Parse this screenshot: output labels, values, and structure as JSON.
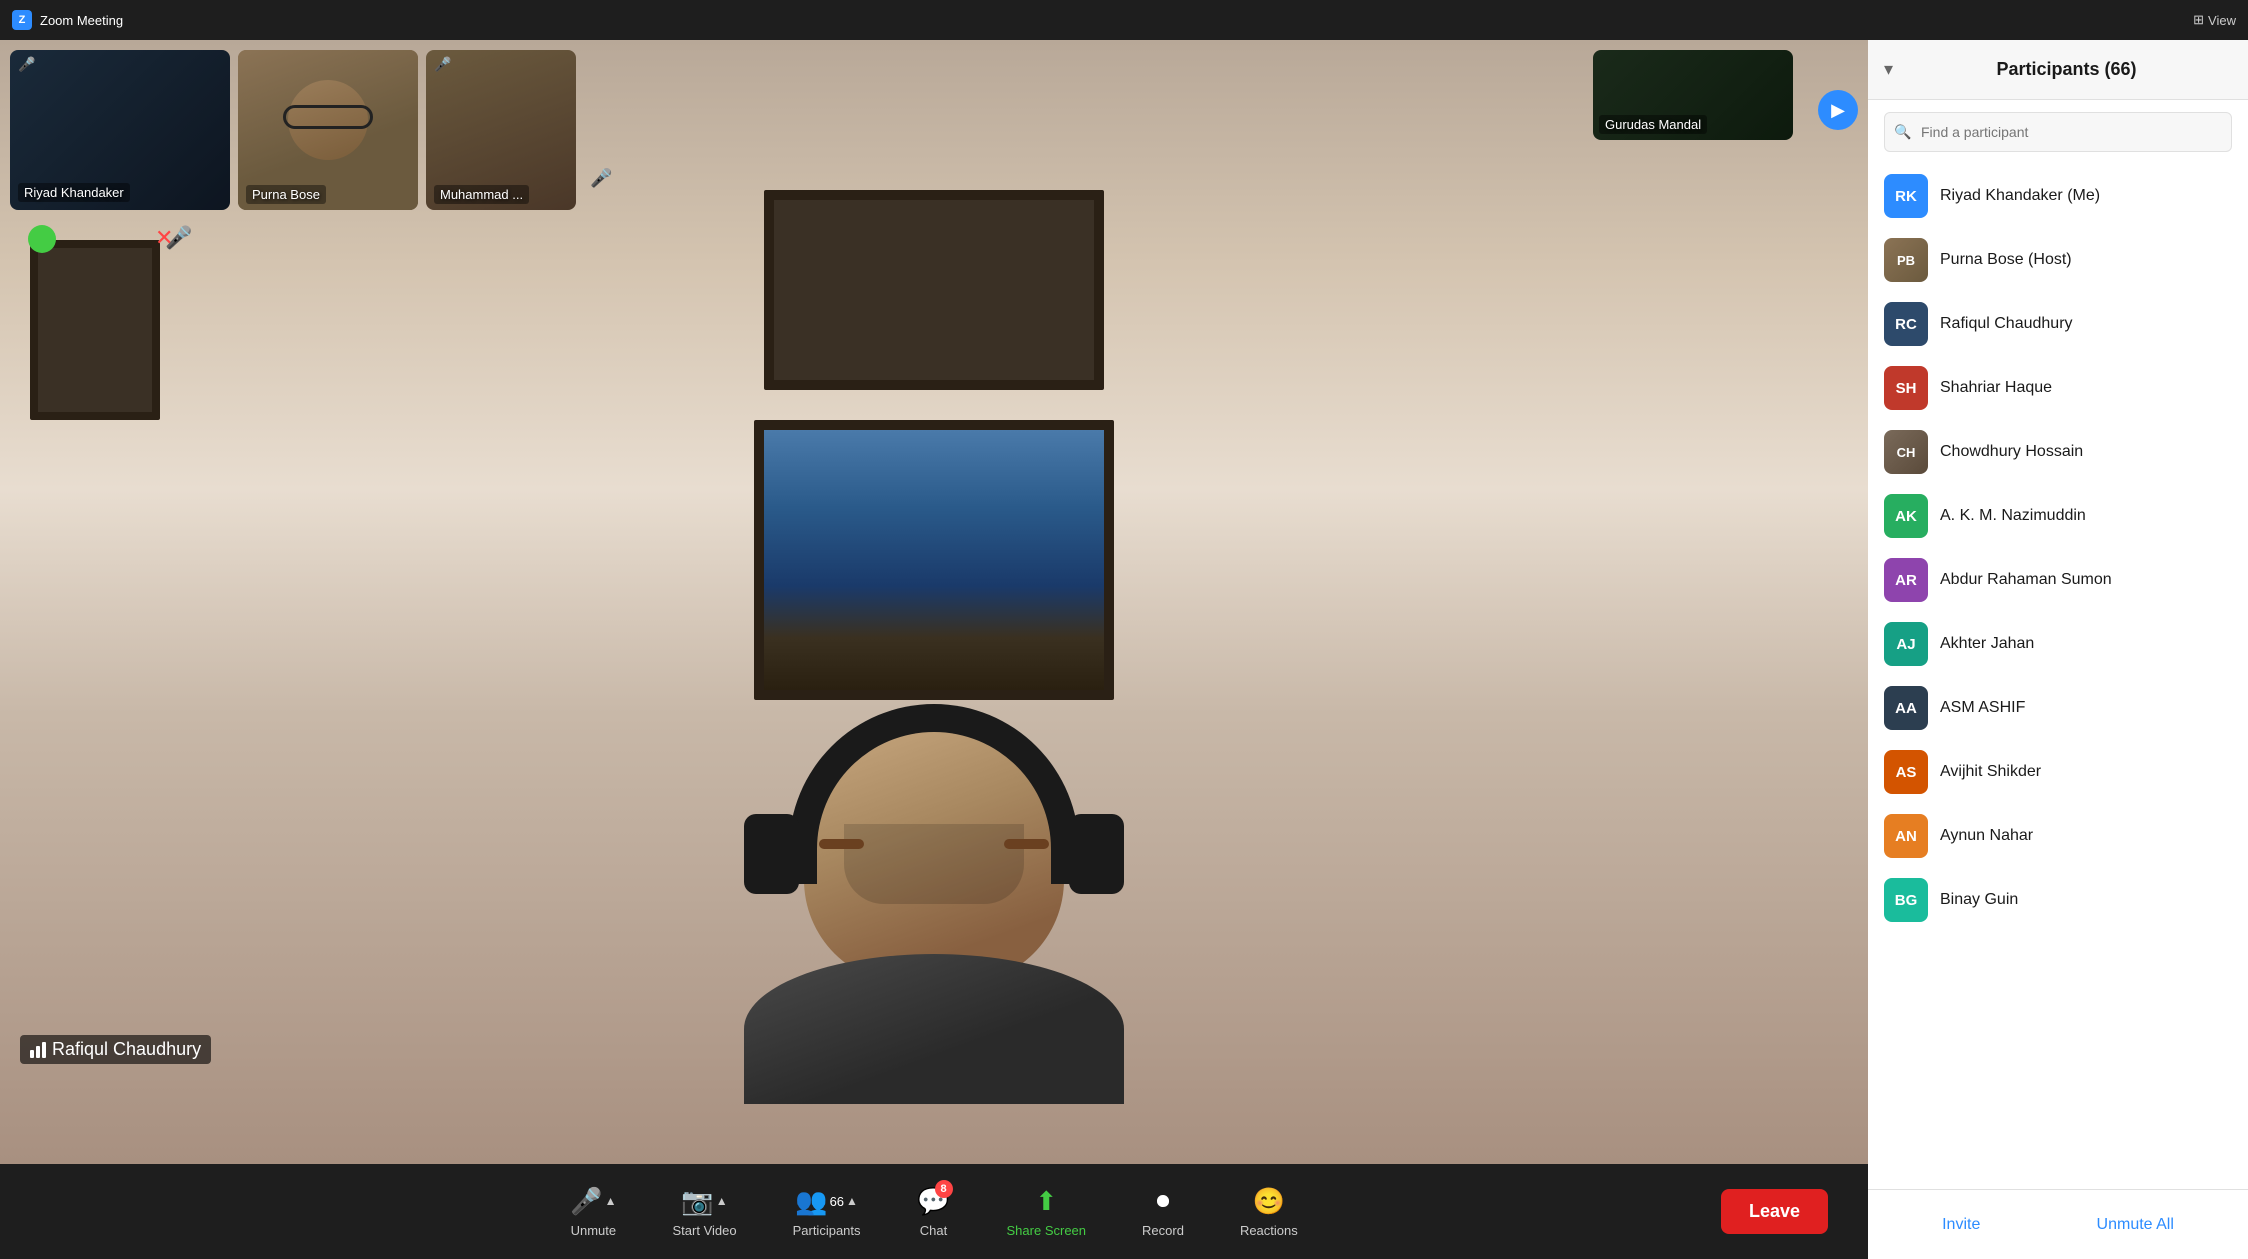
{
  "titleBar": {
    "icon": "Z",
    "title": "Zoom Meeting",
    "viewLabel": "View"
  },
  "videoArea": {
    "participants": [
      {
        "id": "riyad",
        "name": "Riyad Khandaker",
        "muted": true
      },
      {
        "id": "purna",
        "name": "Purna Bose",
        "muted": false
      },
      {
        "id": "muhammad",
        "name": "Muhammad ...",
        "muted": true
      },
      {
        "id": "gurudas",
        "name": "Gurudas Mandal",
        "muted": true
      }
    ],
    "mainParticipant": "Rafiqul Chaudhury",
    "nextArrow": "▶"
  },
  "toolbar": {
    "muteLabel": "Unmute",
    "videoLabel": "Start Video",
    "participantsLabel": "Participants",
    "participantsCount": "66",
    "chatLabel": "Chat",
    "chatBadge": "8",
    "shareScreenLabel": "Share Screen",
    "recordLabel": "Record",
    "reactionsLabel": "Reactions",
    "leaveLabel": "Leave"
  },
  "participantsPanel": {
    "title": "Participants (66)",
    "searchPlaceholder": "Find a participant",
    "collapseIcon": "▾",
    "participants": [
      {
        "id": "rk",
        "initials": "RK",
        "name": "Riyad Khandaker (Me)",
        "color": "#2d8cff",
        "hasPhoto": false
      },
      {
        "id": "pb",
        "initials": "PB",
        "name": "Purna Bose (Host)",
        "color": null,
        "hasPhoto": true
      },
      {
        "id": "rc",
        "initials": "RC",
        "name": "Rafiqul Chaudhury",
        "color": "#2d4a6b",
        "hasPhoto": false
      },
      {
        "id": "sh",
        "initials": "SH",
        "name": "Shahriar Haque",
        "color": "#c0392b",
        "hasPhoto": false
      },
      {
        "id": "ch",
        "initials": "CH",
        "name": "Chowdhury Hossain",
        "color": null,
        "hasPhoto": true
      },
      {
        "id": "ak",
        "initials": "AK",
        "name": "A. K. M. Nazimuddin",
        "color": "#27ae60",
        "hasPhoto": false
      },
      {
        "id": "ar",
        "initials": "AR",
        "name": "Abdur Rahaman Sumon",
        "color": "#8e44ad",
        "hasPhoto": false
      },
      {
        "id": "aj",
        "initials": "AJ",
        "name": "Akhter Jahan",
        "color": "#16a085",
        "hasPhoto": false
      },
      {
        "id": "aa",
        "initials": "AA",
        "name": "ASM ASHIF",
        "color": "#2c3e50",
        "hasPhoto": false
      },
      {
        "id": "as",
        "initials": "AS",
        "name": "Avijhit Shikder",
        "color": "#d35400",
        "hasPhoto": false
      },
      {
        "id": "an",
        "initials": "AN",
        "name": "Aynun Nahar",
        "color": "#e67e22",
        "hasPhoto": false
      },
      {
        "id": "bg",
        "initials": "BG",
        "name": "Binay Guin",
        "color": "#1abc9c",
        "hasPhoto": false
      }
    ],
    "inviteLabel": "Invite",
    "unmuteAllLabel": "Unmute All"
  }
}
